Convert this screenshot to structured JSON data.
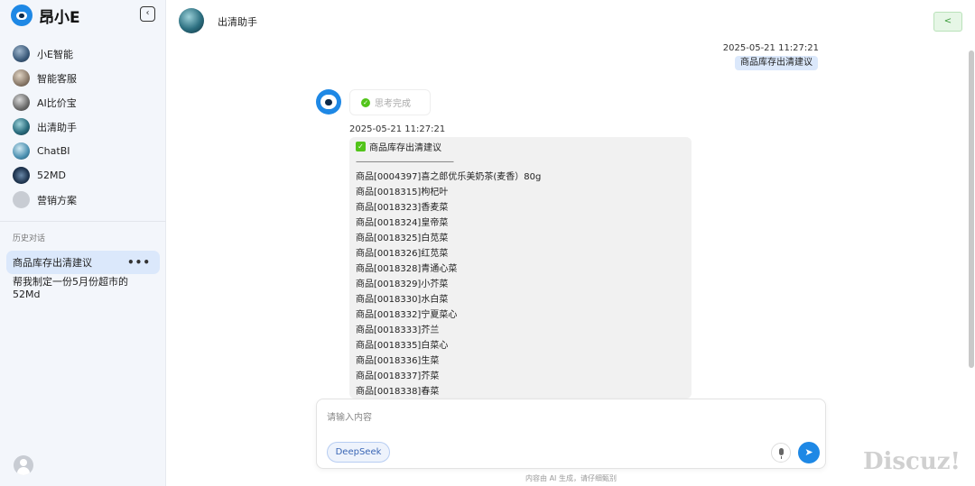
{
  "brand": {
    "title": "昂小E",
    "logo_color": "#1e88e5"
  },
  "sidebar": {
    "collapse_icon": "panel-collapse-icon",
    "nav": [
      {
        "label": "小E智能",
        "icon_color": "#3b5a7a"
      },
      {
        "label": "智能客服",
        "icon_color": "#8a7a6a"
      },
      {
        "label": "AI比价宝",
        "icon_color": "#6a6a6a"
      },
      {
        "label": "出清助手",
        "icon_color": "#2c6f80"
      },
      {
        "label": "ChatBI",
        "icon_color": "#4a8fb0"
      },
      {
        "label": "52MD",
        "icon_color": "#1f3550"
      },
      {
        "label": "营销方案",
        "icon_color": "#c8ccd3"
      }
    ],
    "history_title": "历史对话",
    "history": [
      {
        "label": "商品库存出清建议",
        "more": "•••"
      },
      {
        "label": "帮我制定一份5月份超市的52Md"
      }
    ]
  },
  "header": {
    "title": "出清助手",
    "share_icon": "share-icon"
  },
  "chat": {
    "user_time": "2025-05-21 11:27:21",
    "user_message": "商品库存出清建议",
    "thinking_label": "思考完成",
    "bot_time": "2025-05-21 11:27:21",
    "bot_heading": "商品库存出清建议",
    "bot_separator": "————————————",
    "bot_lines": [
      "商品[0004397]喜之郎优乐美奶茶(麦香）80g",
      "商品[0018315]枸杞叶",
      "商品[0018323]香麦菜",
      "商品[0018324]皇帝菜",
      "商品[0018325]白苋菜",
      "商品[0018326]红苋菜",
      "商品[0018328]青通心菜",
      "商品[0018329]小芥菜",
      "商品[0018330]水白菜",
      "商品[0018332]宁夏菜心",
      "商品[0018333]芥兰",
      "商品[0018335]白菜心",
      "商品[0018336]生菜",
      "商品[0018337]芥菜",
      "商品[0018338]春菜"
    ]
  },
  "input": {
    "placeholder": "请输入内容",
    "model_label": "DeepSeek",
    "footer_note": "内容由 AI 生成，请仔细甄别"
  },
  "colors": {
    "accent": "#1e88e5",
    "success": "#52c41a",
    "active_bg": "#dbe8fb"
  },
  "watermark": "Discuz!"
}
